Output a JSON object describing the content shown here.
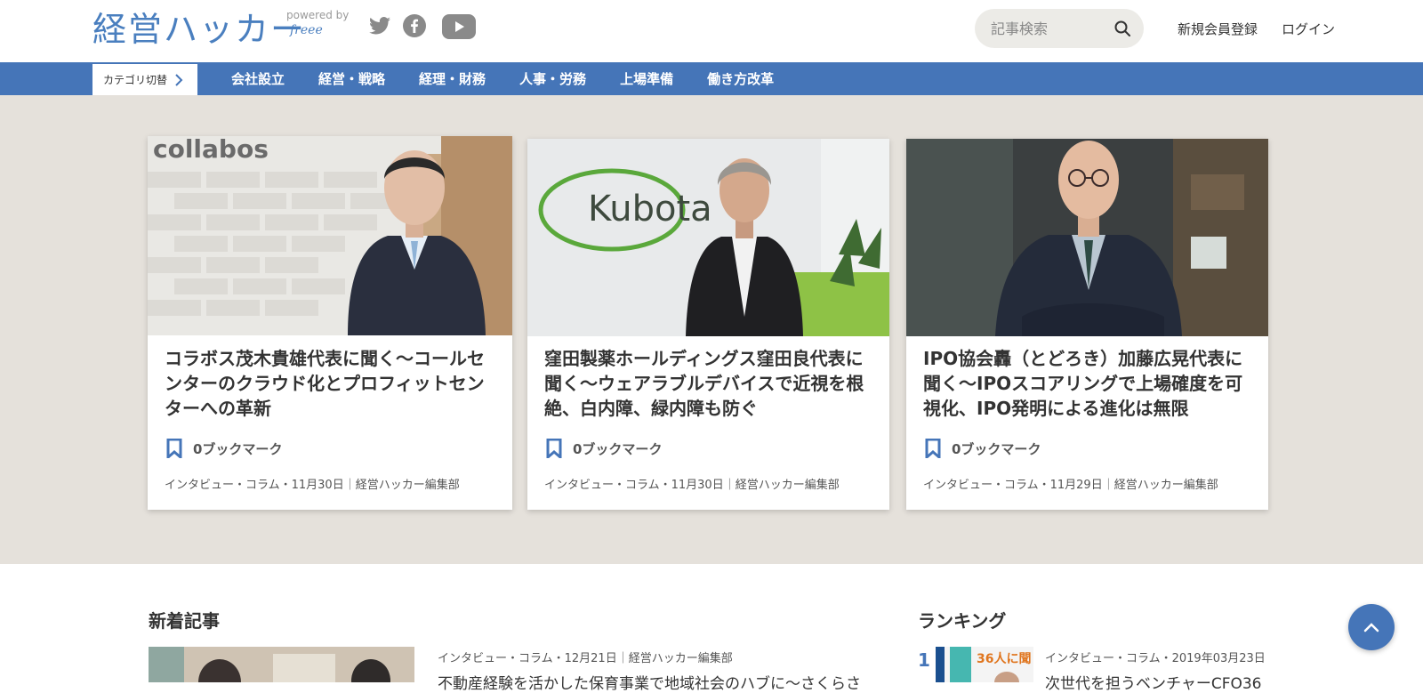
{
  "header": {
    "logo_text": "経営ハッカー",
    "powered_by": "powered by",
    "freee": "freee",
    "search_placeholder": "記事検索",
    "register_label": "新規会員登録",
    "login_label": "ログイン"
  },
  "nav": {
    "category_switch": "カテゴリ切替",
    "items": [
      "会社設立",
      "経営・戦略",
      "経理・財務",
      "人事・労務",
      "上場準備",
      "働き方改革"
    ]
  },
  "featured": [
    {
      "photo_sign": "collabos",
      "title": "コラボス茂木貴雄代表に聞く〜コールセンターのクラウド化とプロフィットセンターへの革新",
      "bookmark": "0ブックマーク",
      "meta": "インタビュー・コラム・11月30日｜経営ハッカー編集部"
    },
    {
      "photo_sign": "Kubota",
      "title": "窪田製薬ホールディングス窪田良代表に聞く〜ウェアラブルデバイスで近視を根絶、白内障、緑内障も防ぐ",
      "bookmark": "0ブックマーク",
      "meta": "インタビュー・コラム・11月30日｜経営ハッカー編集部"
    },
    {
      "title": "IPO協会轟（とどろき）加藤広晃代表に聞く〜IPOスコアリングで上場確度を可視化、IPO発明による進化は無限",
      "bookmark": "0ブックマーク",
      "meta": "インタビュー・コラム・11月29日｜経営ハッカー編集部"
    }
  ],
  "new_articles": {
    "title": "新着記事",
    "items": [
      {
        "meta": "インタビュー・コラム・12月21日｜経営ハッカー編集部",
        "headline": "不動産経験を活かした保育事業で地域社会のハブに〜さくらさ"
      }
    ]
  },
  "ranking": {
    "title": "ランキング",
    "items": [
      {
        "rank": "1",
        "thumb_text": "36人に聞",
        "meta": "インタビュー・コラム・2019年03月23日",
        "headline": "次世代を担うベンチャーCFO36"
      }
    ]
  },
  "colors": {
    "brand_blue": "#4575b8",
    "featured_bg": "#e5e1db"
  }
}
